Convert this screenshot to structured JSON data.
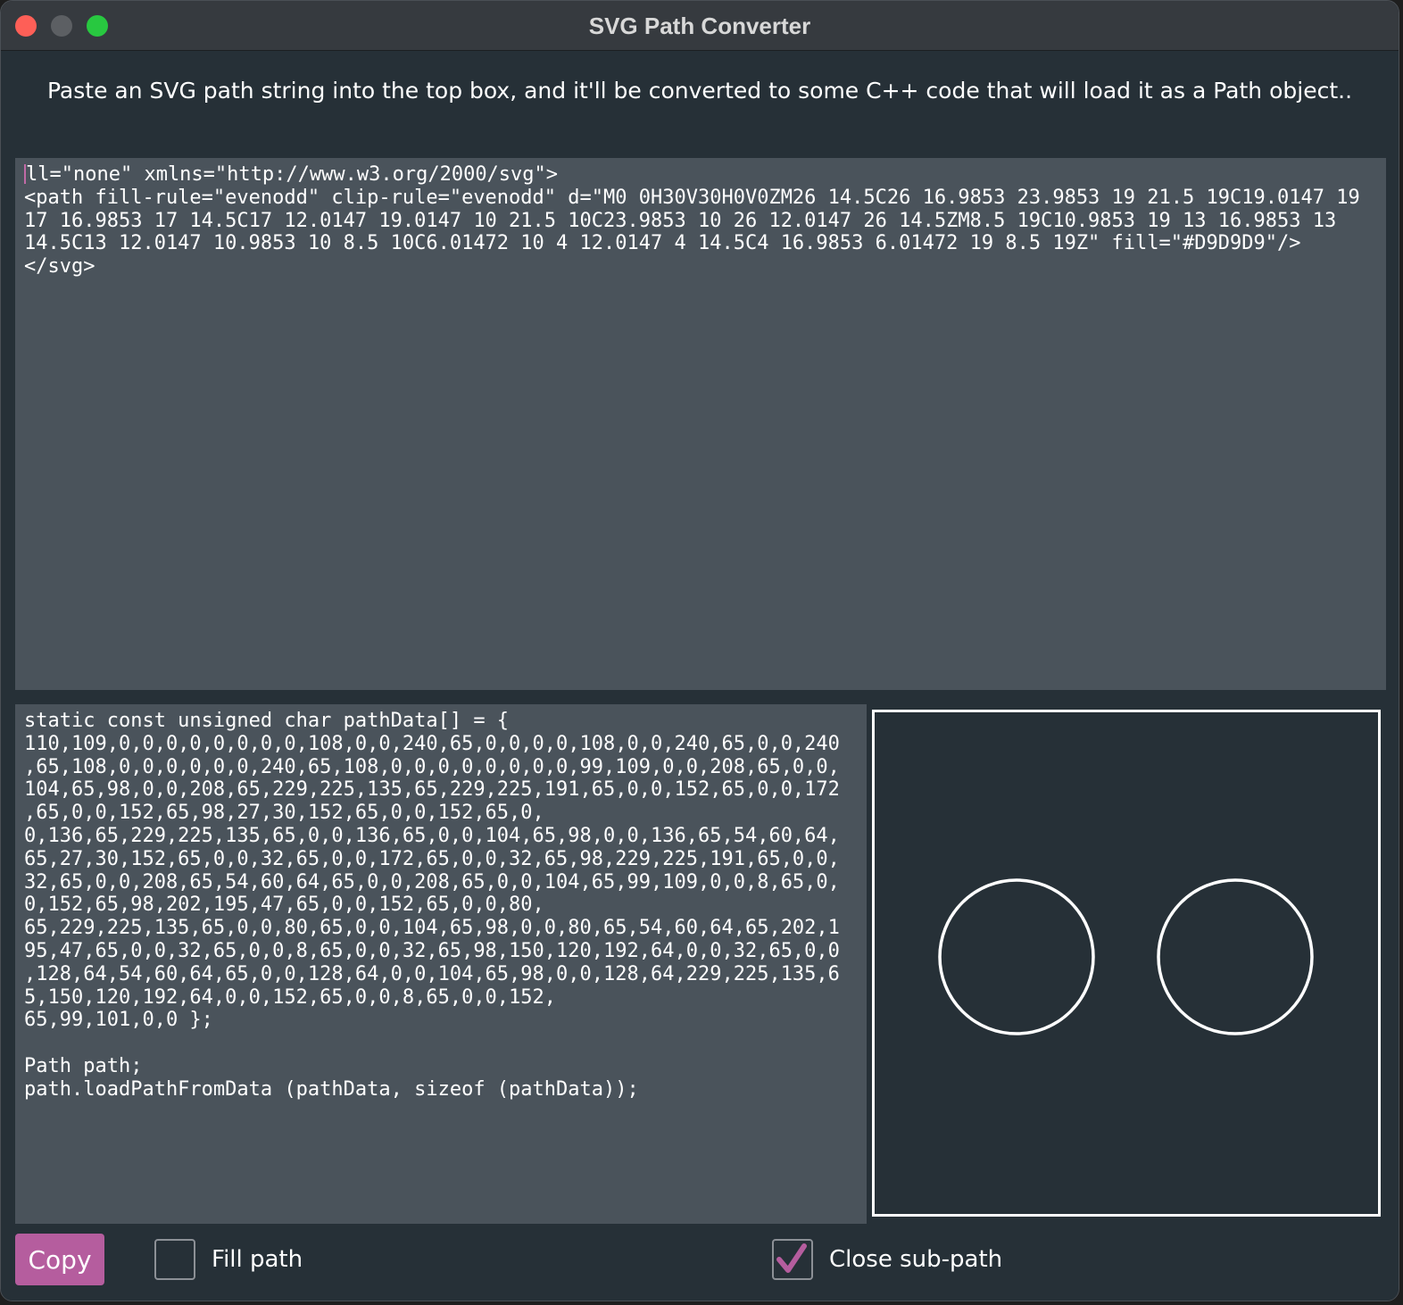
{
  "window": {
    "title": "SVG Path Converter"
  },
  "instructions": "Paste an SVG path string into the top box, and it'll be converted to some C++ code that will load it as a Path object..",
  "input_box": {
    "text": "ll=\"none\" xmlns=\"http://www.w3.org/2000/svg\">\n<path fill-rule=\"evenodd\" clip-rule=\"evenodd\" d=\"M0 0H30V30H0V0ZM26 14.5C26 16.9853 23.9853 19 21.5 19C19.0147 19\n17 16.9853 17 14.5C17 12.0147 19.0147 10 21.5 10C23.9853 10 26 12.0147 26 14.5ZM8.5 19C10.9853 19 13 16.9853 13\n14.5C13 12.0147 10.9853 10 8.5 10C6.01472 10 4 12.0147 4 14.5C4 16.9853 6.01472 19 8.5 19Z\" fill=\"#D9D9D9\"/>\n</svg>"
  },
  "output_box": {
    "text": "static const unsigned char pathData[] = {\n110,109,0,0,0,0,0,0,0,0,108,0,0,240,65,0,0,0,0,108,0,0,240,65,0,0,240\n,65,108,0,0,0,0,0,0,240,65,108,0,0,0,0,0,0,0,0,99,109,0,0,208,65,0,0,\n104,65,98,0,0,208,65,229,225,135,65,229,225,191,65,0,0,152,65,0,0,172\n,65,0,0,152,65,98,27,30,152,65,0,0,152,65,0,\n0,136,65,229,225,135,65,0,0,136,65,0,0,104,65,98,0,0,136,65,54,60,64,\n65,27,30,152,65,0,0,32,65,0,0,172,65,0,0,32,65,98,229,225,191,65,0,0,\n32,65,0,0,208,65,54,60,64,65,0,0,208,65,0,0,104,65,99,109,0,0,8,65,0,\n0,152,65,98,202,195,47,65,0,0,152,65,0,0,80,\n65,229,225,135,65,0,0,80,65,0,0,104,65,98,0,0,80,65,54,60,64,65,202,1\n95,47,65,0,0,32,65,0,0,8,65,0,0,32,65,98,150,120,192,64,0,0,32,65,0,0\n,128,64,54,60,64,65,0,0,128,64,0,0,104,65,98,0,0,128,64,229,225,135,6\n5,150,120,192,64,0,0,152,65,0,0,8,65,0,0,152,\n65,99,101,0,0 };\n\nPath path;\npath.loadPathFromData (pathData, sizeof (pathData));"
  },
  "controls": {
    "copy_label": "Copy",
    "fill_path_label": "Fill path",
    "fill_path_checked": false,
    "close_subpath_label": "Close sub-path",
    "close_subpath_checked": true
  },
  "colors": {
    "accent": "#b55d9e",
    "editor_bg": "#4a535b",
    "window_bg": "#263037",
    "preview_stroke": "#ffffff"
  }
}
